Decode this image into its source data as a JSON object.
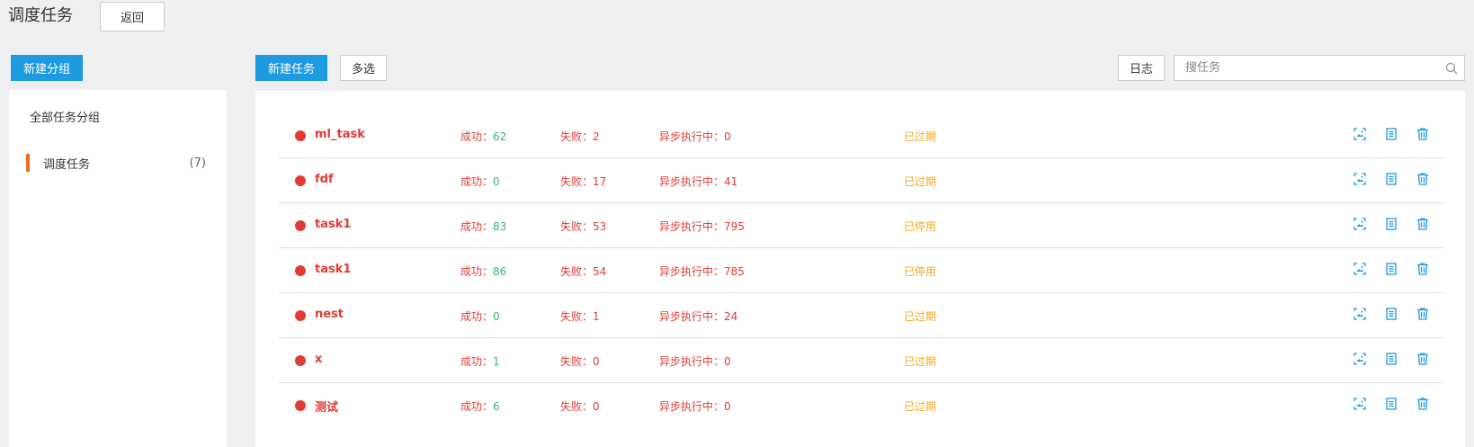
{
  "header": {
    "title": "调度任务",
    "back_label": "返回"
  },
  "toolbar": {
    "new_group_label": "新建分组",
    "new_task_label": "新建任务",
    "multi_select_label": "多选",
    "log_label": "日志",
    "search_placeholder": "搜任务"
  },
  "sidebar": {
    "all_groups_label": "全部任务分组",
    "groups": [
      {
        "name": "调度任务",
        "count": "(7)"
      }
    ]
  },
  "colors": {
    "primary": "#1e9ae0",
    "accent": "#f26b1d",
    "danger": "#e23b34",
    "success": "#3cb371",
    "warning": "#f0a820"
  },
  "icons": [
    "image-icon",
    "document-icon",
    "trash-icon",
    "search-icon"
  ],
  "tasks": [
    {
      "name": "ml_task",
      "success_label": "成功：",
      "success": "62",
      "fail": "失败：2",
      "async": "异步执行中：0",
      "status": "已过期"
    },
    {
      "name": "fdf",
      "success_label": "成功：",
      "success": "0",
      "fail": "失败：17",
      "async": "异步执行中：41",
      "status": "已过期"
    },
    {
      "name": "task1",
      "success_label": "成功：",
      "success": "83",
      "fail": "失败：53",
      "async": "异步执行中：795",
      "status": "已停用"
    },
    {
      "name": "task1",
      "success_label": "成功：",
      "success": "86",
      "fail": "失败：54",
      "async": "异步执行中：785",
      "status": "已停用"
    },
    {
      "name": "nest",
      "success_label": "成功：",
      "success": "0",
      "fail": "失败：1",
      "async": "异步执行中：24",
      "status": "已过期"
    },
    {
      "name": "x",
      "success_label": "成功：",
      "success": "1",
      "fail": "失败：0",
      "async": "异步执行中：0",
      "status": "已过期"
    },
    {
      "name": "测试",
      "success_label": "成功：",
      "success": "6",
      "fail": "失败：0",
      "async": "异步执行中：0",
      "status": "已过期"
    }
  ]
}
